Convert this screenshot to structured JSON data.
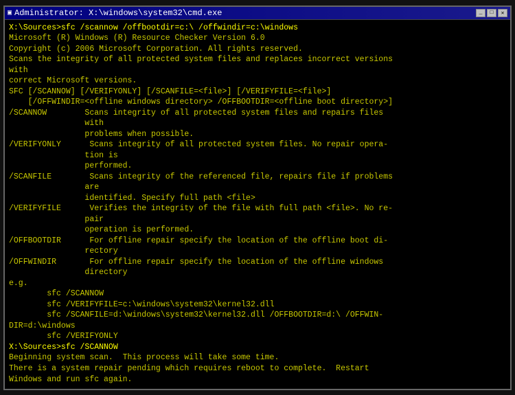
{
  "window": {
    "title": "Administrator: X:\\windows\\system32\\cmd.exe",
    "title_icon": "cmd-icon"
  },
  "console": {
    "lines": [
      {
        "text": "X:\\Sources>sfc /scannow /offbootdir=c:\\ /offwindir=c:\\windows",
        "style": "bright"
      },
      {
        "text": "",
        "style": "normal"
      },
      {
        "text": "Microsoft (R) Windows (R) Resource Checker Version 6.0",
        "style": "normal"
      },
      {
        "text": "Copyright (c) 2006 Microsoft Corporation. All rights reserved.",
        "style": "normal"
      },
      {
        "text": "",
        "style": "normal"
      },
      {
        "text": "Scans the integrity of all protected system files and replaces incorrect versions",
        "style": "normal"
      },
      {
        "text": "with",
        "style": "normal"
      },
      {
        "text": "correct Microsoft versions.",
        "style": "normal"
      },
      {
        "text": "",
        "style": "normal"
      },
      {
        "text": "SFC [/SCANNOW] [/VERIFYONLY] [/SCANFILE=<file>] [/VERIFYFILE=<file>]",
        "style": "normal"
      },
      {
        "text": "    [/OFFWINDIR=<offline windows directory> /OFFBOOTDIR=<offline boot directory>]",
        "style": "normal"
      },
      {
        "text": "",
        "style": "normal"
      },
      {
        "text": "/SCANNOW        Scans integrity of all protected system files and repairs files",
        "style": "normal"
      },
      {
        "text": "                with",
        "style": "normal"
      },
      {
        "text": "                problems when possible.",
        "style": "normal"
      },
      {
        "text": "/VERIFYONLY      Scans integrity of all protected system files. No repair opera-",
        "style": "normal"
      },
      {
        "text": "                tion is",
        "style": "normal"
      },
      {
        "text": "                performed.",
        "style": "normal"
      },
      {
        "text": "/SCANFILE        Scans integrity of the referenced file, repairs file if problems",
        "style": "normal"
      },
      {
        "text": "                are",
        "style": "normal"
      },
      {
        "text": "                identified. Specify full path <file>",
        "style": "normal"
      },
      {
        "text": "/VERIFYFILE      Verifies the integrity of the file with full path <file>. No re-",
        "style": "normal"
      },
      {
        "text": "                pair",
        "style": "normal"
      },
      {
        "text": "                operation is performed.",
        "style": "normal"
      },
      {
        "text": "/OFFBOOTDIR      For offline repair specify the location of the offline boot di-",
        "style": "normal"
      },
      {
        "text": "                rectory",
        "style": "normal"
      },
      {
        "text": "/OFFWINDIR       For offline repair specify the location of the offline windows",
        "style": "normal"
      },
      {
        "text": "                directory",
        "style": "normal"
      },
      {
        "text": "",
        "style": "normal"
      },
      {
        "text": "e.g.",
        "style": "normal"
      },
      {
        "text": "",
        "style": "normal"
      },
      {
        "text": "        sfc /SCANNOW",
        "style": "normal"
      },
      {
        "text": "        sfc /VERIFYFILE=c:\\windows\\system32\\kernel32.dll",
        "style": "normal"
      },
      {
        "text": "        sfc /SCANFILE=d:\\windows\\system32\\kernel32.dll /OFFBOOTDIR=d:\\ /OFFWIN-",
        "style": "normal"
      },
      {
        "text": "DIR=d:\\windows",
        "style": "normal"
      },
      {
        "text": "        sfc /VERIFYONLY",
        "style": "normal"
      },
      {
        "text": "",
        "style": "normal"
      },
      {
        "text": "X:\\Sources>sfc /SCANNOW",
        "style": "bright"
      },
      {
        "text": "",
        "style": "normal"
      },
      {
        "text": "Beginning system scan.  This process will take some time.",
        "style": "normal"
      },
      {
        "text": "",
        "style": "normal"
      },
      {
        "text": "There is a system repair pending which requires reboot to complete.  Restart",
        "style": "normal"
      },
      {
        "text": "Windows and run sfc again.",
        "style": "normal"
      }
    ]
  },
  "controls": {
    "minimize": "_",
    "maximize": "□",
    "close": "✕"
  }
}
